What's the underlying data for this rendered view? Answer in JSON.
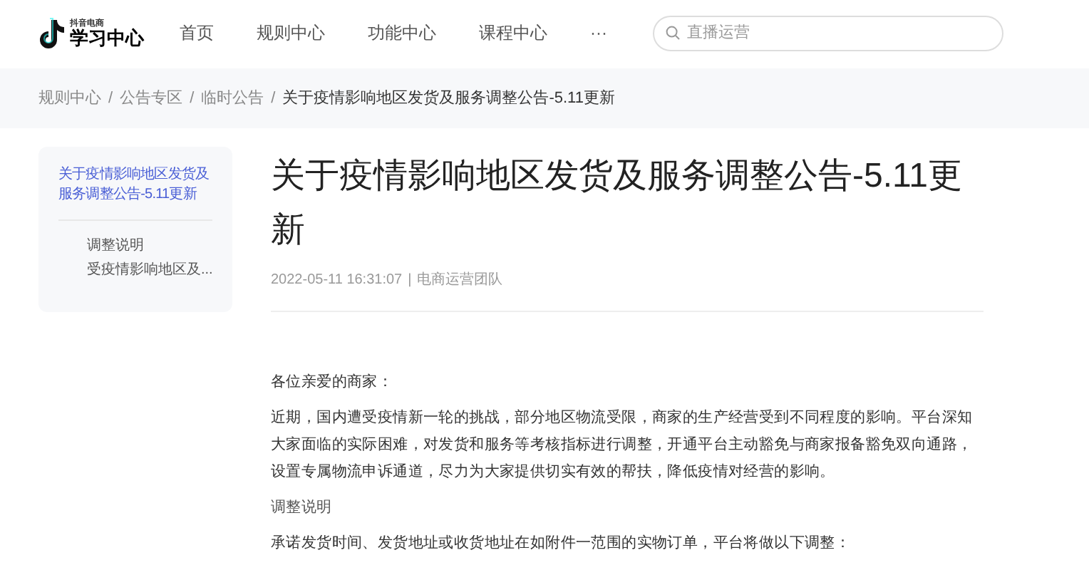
{
  "logo": {
    "small": "抖音电商",
    "main": "学习中心"
  },
  "nav": [
    {
      "label": "首页",
      "selected": false
    },
    {
      "label": "规则中心",
      "selected": false
    },
    {
      "label": "功能中心",
      "selected": false
    },
    {
      "label": "课程中心",
      "selected": false
    },
    {
      "label": "···",
      "selected": false
    }
  ],
  "search": {
    "placeholder": "直播运营"
  },
  "breadcrumb_separator": "/",
  "meta_separator": "|",
  "breadcrumb": [
    "规则中心",
    "公告专区",
    "临时公告",
    "关于疫情影响地区发货及服务调整公告-5.11更新"
  ],
  "toc": {
    "title": {
      "label": "关于疫情影响地区发货及服务调整公告-5.11更新",
      "selected": true
    },
    "items": [
      {
        "label": "调整说明",
        "selected": false
      },
      {
        "label": "受疫情影响地区及...",
        "selected": false
      }
    ]
  },
  "article": {
    "title": "关于疫情影响地区发货及服务调整公告-5.11更新",
    "date": "2022-05-11 16:31:07",
    "author": "电商运营团队",
    "paragraphs": [
      {
        "kind": "text",
        "text": "各位亲爱的商家："
      },
      {
        "kind": "text",
        "text": "近期，国内遭受疫情新一轮的挑战，部分地区物流受限，商家的生产经营受到不同程度的影响。平台深知大家面临的实际困难，对发货和服务等考核指标进行调整，开通平台主动豁免与商家报备豁免双向通路，设置专属物流申诉通道，尽力为大家提供切实有效的帮扶，降低疫情对经营的影响。"
      },
      {
        "kind": "heading",
        "text": "调整说明"
      },
      {
        "kind": "text",
        "text": "承诺发货时间、发货地址或收货地址在如附件一范围的实物订单，平台将做以下调整："
      }
    ]
  }
}
